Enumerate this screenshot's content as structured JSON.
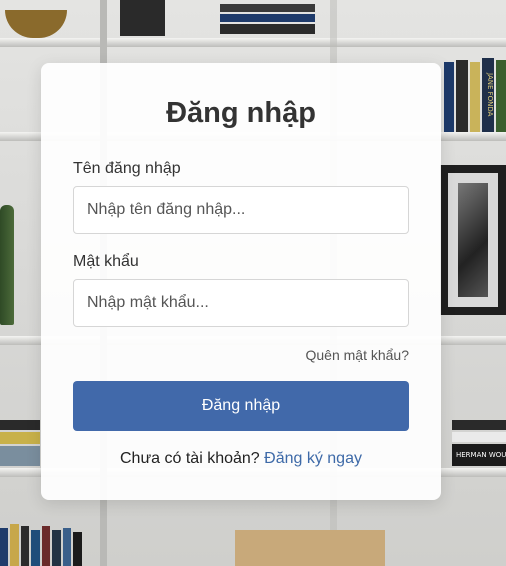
{
  "login": {
    "title": "Đăng nhập",
    "username_label": "Tên đăng nhập",
    "username_placeholder": "Nhập tên đăng nhập...",
    "username_value": "",
    "password_label": "Mật khẩu",
    "password_placeholder": "Nhập mật khẩu...",
    "password_value": "",
    "forgot_password": "Quên mật khẩu?",
    "submit_label": "Đăng nhập",
    "no_account_text": "Chưa có tài khoản?",
    "register_link": "Đăng ký ngay"
  },
  "background": {
    "book_spines": [
      "JANE FONDA",
      "HERMAN WOUK"
    ]
  },
  "colors": {
    "primary_button": "#4169aa",
    "link": "#3e6aa8",
    "card": "#ffffff"
  }
}
